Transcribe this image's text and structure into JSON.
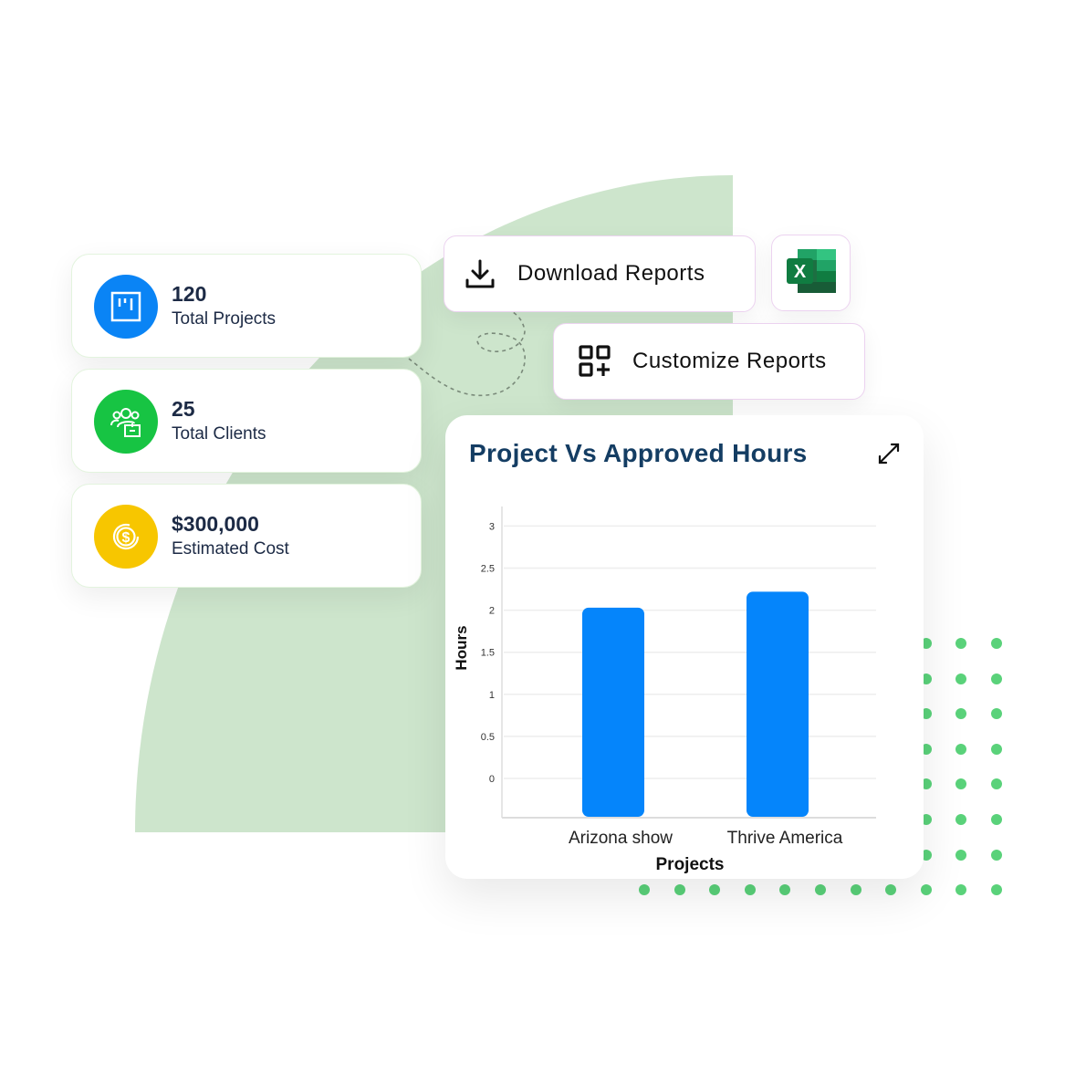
{
  "stats": [
    {
      "value": "120",
      "label": "Total Projects",
      "icon": "kanban-board-icon",
      "color": "#0a84f5"
    },
    {
      "value": "25",
      "label": "Total Clients",
      "icon": "clients-group-icon",
      "color": "#17c443"
    },
    {
      "value": "$300,000",
      "label": "Estimated Cost",
      "icon": "dollar-coin-icon",
      "color": "#f7c600"
    }
  ],
  "actions": {
    "download": {
      "label": "Download Reports",
      "icon": "download-icon"
    },
    "excel": {
      "icon": "excel-icon",
      "letter": "X"
    },
    "customize": {
      "label": "Customize Reports",
      "icon": "grid-add-icon"
    }
  },
  "chart_card": {
    "title": "Project Vs Approved Hours",
    "expand_icon": "expand-icon"
  },
  "colors": {
    "bar": "#0585fb",
    "title": "#143d63",
    "background_shape": "#cde5cc",
    "dots": "#5ad27a"
  },
  "chart_data": {
    "type": "bar",
    "title": "Project Vs Approved Hours",
    "xlabel": "Projects",
    "ylabel": "Hours",
    "categories": [
      "Arizona show",
      "Thrive America"
    ],
    "values": [
      2.03,
      2.22
    ],
    "yticks": [
      "0",
      "0.5",
      "1",
      "1.5",
      "2",
      "2.5",
      "3"
    ],
    "ylim": [
      -0.5,
      3.2
    ],
    "grid": true,
    "legend": "none"
  }
}
